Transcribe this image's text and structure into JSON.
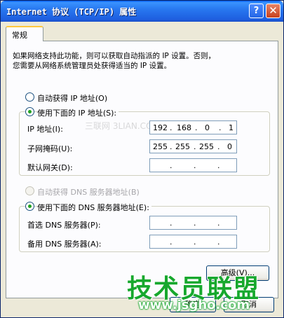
{
  "window": {
    "title": "Internet 协议 (TCP/IP) 属性",
    "help_glyph": "?",
    "close_glyph": "✕"
  },
  "tabs": [
    {
      "label": "常规",
      "active": true
    }
  ],
  "description": {
    "line1": "如果网络支持此功能，则可以获取自动指派的 IP 设置。否则，",
    "line2": "您需要从网络系统管理员处获得适当的 IP 设置。"
  },
  "ip_mode": {
    "auto_label": "自动获得 IP 地址(O)",
    "manual_label": "使用下面的 IP 地址(S):",
    "selected": "manual"
  },
  "ip_fields": {
    "address_label": "IP 地址(I):",
    "address": [
      "192",
      "168",
      "0",
      "1"
    ],
    "mask_label": "子网掩码(U):",
    "mask": [
      "255",
      "255",
      "255",
      "0"
    ],
    "gateway_label": "默认网关(D):",
    "gateway": [
      "",
      "",
      "",
      ""
    ]
  },
  "dns_mode": {
    "auto_label": "自动获得 DNS 服务器地址(B)",
    "manual_label": "使用下面的 DNS 服务器地址(E):",
    "selected": "manual",
    "auto_disabled": true
  },
  "dns_fields": {
    "preferred_label": "首选 DNS 服务器(P):",
    "preferred": [
      "",
      "",
      "",
      ""
    ],
    "alternate_label": "备用 DNS 服务器(A):",
    "alternate": [
      "",
      "",
      "",
      ""
    ]
  },
  "buttons": {
    "advanced": "高级(V)...",
    "ok": "确定",
    "cancel": "取消"
  },
  "watermarks": {
    "center": "三联网 3LIAN.COM",
    "logo": "技术员联盟",
    "url": "www.jsgho.com"
  }
}
